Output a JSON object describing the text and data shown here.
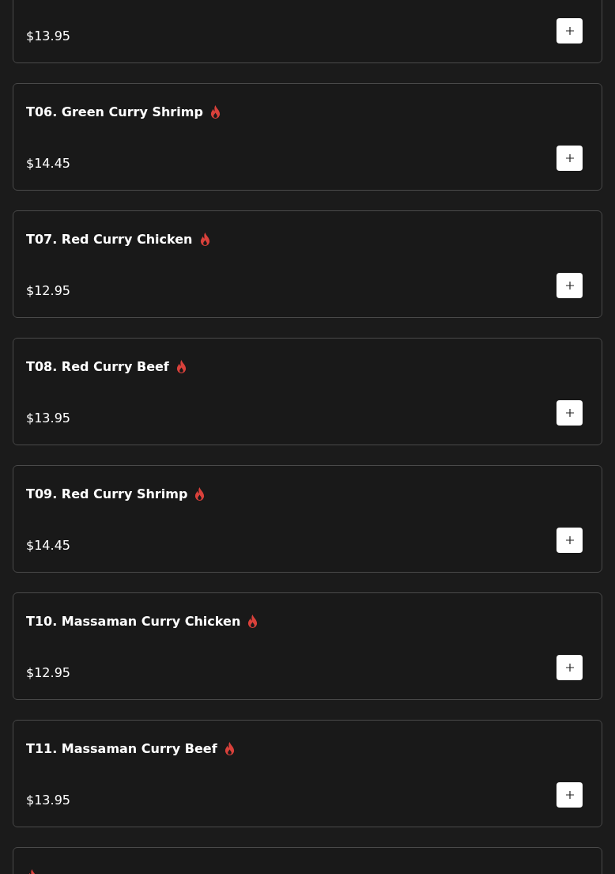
{
  "menu_items": [
    {
      "price": "$13.95"
    },
    {
      "name": "T06. Green Curry Shrimp",
      "spicy": true,
      "price": "$14.45"
    },
    {
      "name": "T07. Red Curry Chicken",
      "spicy": true,
      "price": "$12.95"
    },
    {
      "name": "T08. Red Curry Beef",
      "spicy": true,
      "price": "$13.95"
    },
    {
      "name": "T09. Red Curry Shrimp",
      "spicy": true,
      "price": "$14.45"
    },
    {
      "name": "T10. Massaman Curry Chicken",
      "spicy": true,
      "price": "$12.95"
    },
    {
      "name": "T11. Massaman Curry Beef",
      "spicy": true,
      "price": "$13.95"
    },
    {
      "spicy": true
    }
  ]
}
